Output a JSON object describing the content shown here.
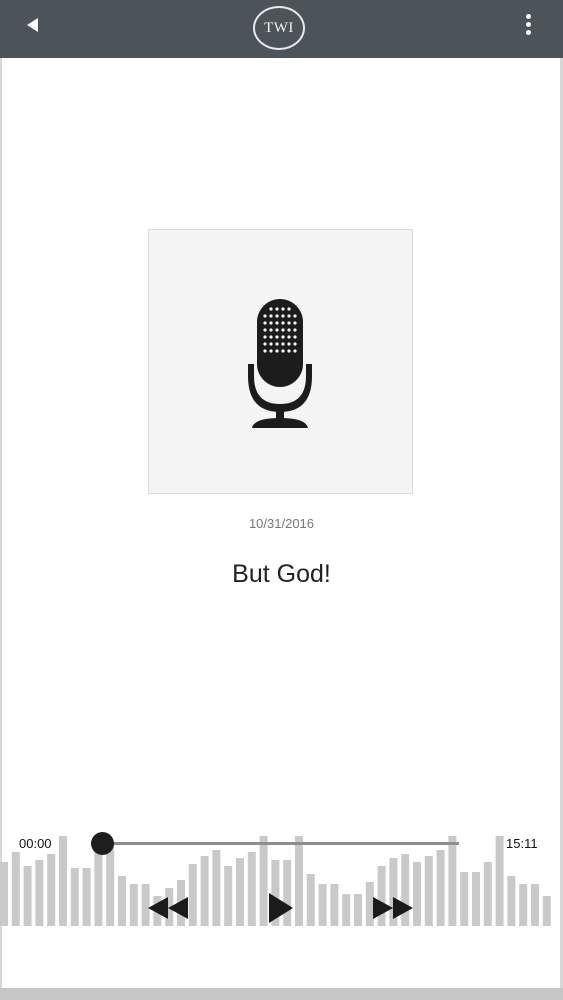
{
  "header": {
    "logo_text": "TWI",
    "back_icon": "back-triangle-icon",
    "menu_icon": "more-vertical-icon",
    "background": "#4d5459"
  },
  "episode": {
    "date": "10/31/2016",
    "title": "But God!",
    "artwork_icon": "microphone-icon"
  },
  "player": {
    "current_time": "00:00",
    "duration": "15:11",
    "progress": 0,
    "controls": [
      "rewind-icon",
      "play-icon",
      "fast-forward-icon"
    ]
  }
}
